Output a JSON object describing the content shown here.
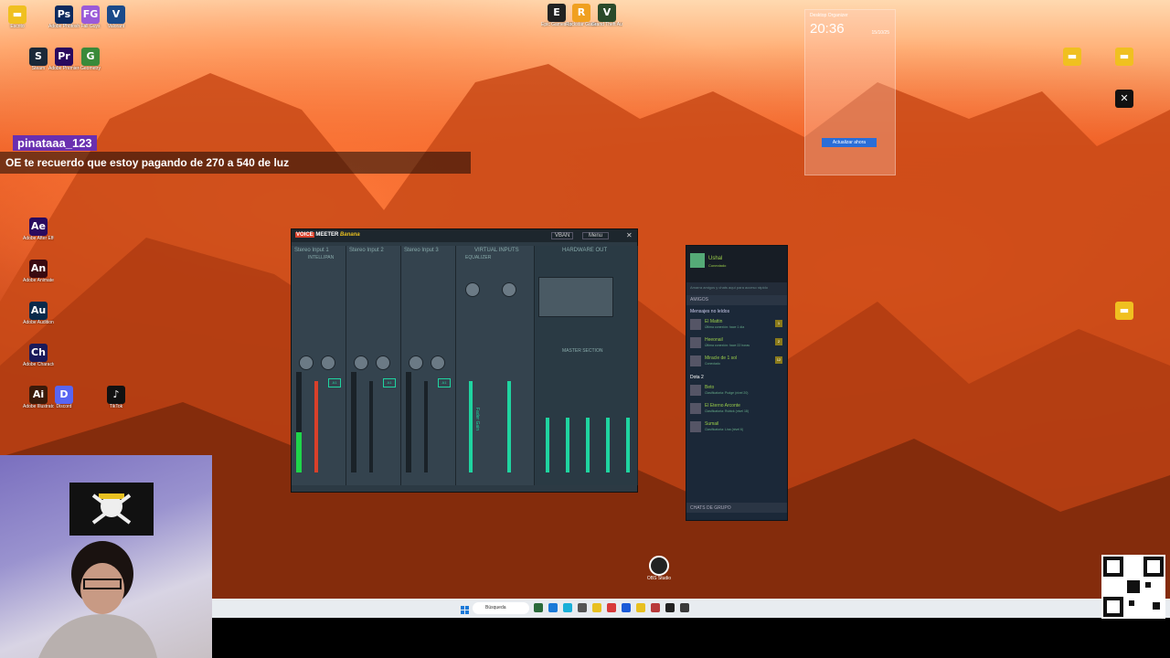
{
  "desktop": {
    "icons": [
      {
        "label": "Escrito",
        "color": "#f0c020",
        "glyph": "▬"
      },
      {
        "label": "Adobe Photoshop",
        "color": "#0c2a5e",
        "glyph": "Ps"
      },
      {
        "label": "Fall Guys",
        "color": "#9a5ad8",
        "glyph": "FG"
      },
      {
        "label": "Valorant",
        "color": "#1a4a8a",
        "glyph": "V"
      },
      {
        "label": "Steam",
        "color": "#1b2838",
        "glyph": "S"
      },
      {
        "label": "Adobe Premiere",
        "color": "#2a0a5e",
        "glyph": "Pr"
      },
      {
        "label": "Geometry",
        "color": "#3a8a3a",
        "glyph": "G"
      },
      {
        "label": "Adobe After Effects",
        "color": "#2a0a5e",
        "glyph": "Ae"
      },
      {
        "label": "Adobe Animate",
        "color": "#3a0a10",
        "glyph": "An"
      },
      {
        "label": "Adobe Audition",
        "color": "#0a2a4a",
        "glyph": "Au"
      },
      {
        "label": "Adobe Character",
        "color": "#1a1a5a",
        "glyph": "Ch"
      },
      {
        "label": "Adobe Illustrator",
        "color": "#3a1a0a",
        "glyph": "Ai"
      },
      {
        "label": "Discord",
        "color": "#5865f2",
        "glyph": "D"
      },
      {
        "label": "TikTok",
        "color": "#111111",
        "glyph": "♪"
      }
    ],
    "top_icons": [
      {
        "label": "Epic Games Launcher",
        "color": "#222222",
        "glyph": "E"
      },
      {
        "label": "Rockstar Games Launcher",
        "color": "#f0a020",
        "glyph": "R"
      },
      {
        "label": "Grand Theft Auto V",
        "color": "#2a4a2a",
        "glyph": "V"
      }
    ],
    "right_icons": [
      {
        "label": "",
        "color": "#f0c020",
        "glyph": "▬"
      },
      {
        "label": "",
        "color": "#f0c020",
        "glyph": "▬"
      },
      {
        "label": "",
        "color": "#ffffff",
        "glyph": "✕"
      }
    ]
  },
  "chat": {
    "username": "pinataaa_123",
    "message": "OE te recuerdo que estoy pagando de 270 a 540 de luz"
  },
  "widget": {
    "title": "Desktop Organizer",
    "time": "20:36",
    "date": "15/10/25",
    "button": "Actualizar ahora"
  },
  "voicemeeter": {
    "brand_voice": "VOICE",
    "brand_meeter": "MEETER",
    "brand_banana": "Banana",
    "vban": "VBAN",
    "menu": "Menu",
    "strips": [
      {
        "title": "Stereo Input 1"
      },
      {
        "title": "Stereo Input 2"
      },
      {
        "title": "Stereo Input 3"
      },
      {
        "title": "VIRTUAL INPUTS"
      },
      {
        "title": "HARDWARE OUT"
      }
    ],
    "master": "MASTER SECTION",
    "intellipan": "INTELLIPAN",
    "equalizer": "EQUALIZER",
    "fader_label": "Fader Gain"
  },
  "steam": {
    "user": "Ushal",
    "status": "Conectado",
    "search_placeholder": "Amarra amigos y chats aquí para acceso rápido",
    "amigos": "AMIGOS",
    "unread": "Mensajes no leídos",
    "friends": [
      {
        "name": "El Mattin",
        "state": "Última conexión: hace 1 día",
        "badge": "1"
      },
      {
        "name": "Heeonail",
        "state": "Última conexión: hace 22 horas",
        "badge": "2"
      },
      {
        "name": "Miracle de 1 sol",
        "state": "Conectado",
        "badge": "12"
      }
    ],
    "group": "Dota 2",
    "players": [
      {
        "name": "Beto",
        "state": "Clasificatoria: Pudge (nivel 20)"
      },
      {
        "name": "El Eterno Arconte",
        "state": "Clasificatoria: Rubick (nivel 18)"
      },
      {
        "name": "Sumail",
        "state": "Clasificatoria: Lina (nivel 6)"
      }
    ],
    "group_chats": "CHATS DE GRUPO"
  },
  "obs": {
    "label": "OBS Studio"
  },
  "taskbar": {
    "search": "Búsqueda"
  },
  "taskbar_icons": [
    "#2a6a3a",
    "#1a7ad8",
    "#1ab0d8",
    "#555555",
    "#e8c020",
    "#d83a3a",
    "#1a5ad8",
    "#e8c020",
    "#b83a3a",
    "#222222",
    "#3a3a3a"
  ]
}
